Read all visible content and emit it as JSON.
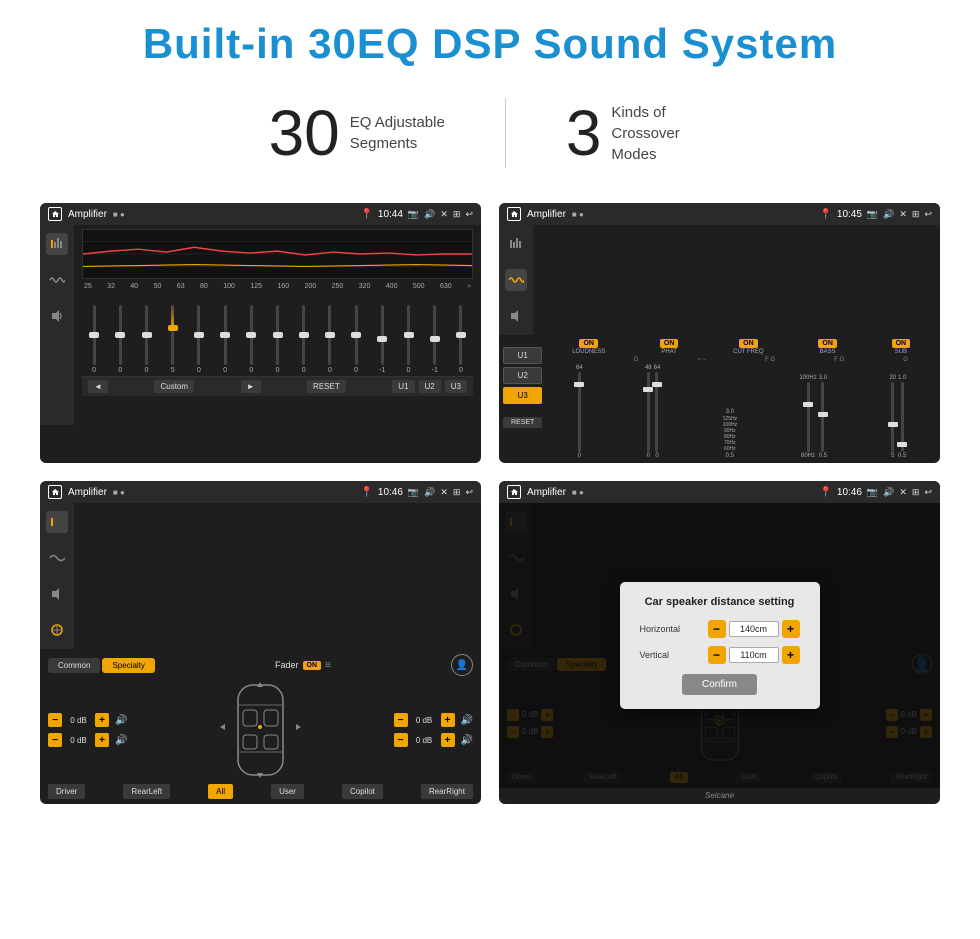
{
  "page": {
    "title": "Built-in 30EQ DSP Sound System",
    "title_color": "#1a8fd1"
  },
  "stats": [
    {
      "number": "30",
      "desc_line1": "EQ Adjustable",
      "desc_line2": "Segments"
    },
    {
      "number": "3",
      "desc_line1": "Kinds of",
      "desc_line2": "Crossover Modes"
    }
  ],
  "screens": [
    {
      "id": "eq",
      "status": {
        "app": "Amplifier",
        "time": "10:44"
      },
      "freq_labels": [
        "25",
        "32",
        "40",
        "50",
        "63",
        "80",
        "100",
        "125",
        "160",
        "200",
        "250",
        "320",
        "400",
        "500",
        "630"
      ],
      "sliders": [
        {
          "value": "0",
          "pos": 50
        },
        {
          "value": "0",
          "pos": 50
        },
        {
          "value": "0",
          "pos": 50
        },
        {
          "value": "5",
          "pos": 42
        },
        {
          "value": "0",
          "pos": 50
        },
        {
          "value": "0",
          "pos": 50
        },
        {
          "value": "0",
          "pos": 50
        },
        {
          "value": "0",
          "pos": 50
        },
        {
          "value": "0",
          "pos": 50
        },
        {
          "value": "0",
          "pos": 50
        },
        {
          "value": "0",
          "pos": 50
        },
        {
          "value": "-1",
          "pos": 54
        },
        {
          "value": "0",
          "pos": 50
        },
        {
          "value": "-1",
          "pos": 54
        },
        {
          "value": "0",
          "pos": 50
        }
      ],
      "bottom_buttons": [
        "Custom",
        "RESET",
        "U1",
        "U2",
        "U3"
      ]
    },
    {
      "id": "crossover",
      "status": {
        "app": "Amplifier",
        "time": "10:45"
      },
      "presets": [
        "U1",
        "U2",
        "U3"
      ],
      "active_preset": "U3",
      "channels": [
        {
          "label": "LOUDNESS",
          "on": true
        },
        {
          "label": "PHAT",
          "on": true
        },
        {
          "label": "CUT FREQ",
          "on": true
        },
        {
          "label": "BASS",
          "on": true
        },
        {
          "label": "SUB",
          "on": true
        }
      ],
      "reset_label": "RESET"
    },
    {
      "id": "fader",
      "status": {
        "app": "Amplifier",
        "time": "10:46"
      },
      "tabs": [
        "Common",
        "Specialty"
      ],
      "active_tab": "Specialty",
      "fader_label": "Fader",
      "fader_on": "ON",
      "db_controls": [
        {
          "label": "0 dB"
        },
        {
          "label": "0 dB"
        },
        {
          "label": "0 dB"
        },
        {
          "label": "0 dB"
        }
      ],
      "position_buttons": [
        "Driver",
        "RearLeft",
        "All",
        "User",
        "Copilot",
        "RearRight"
      ]
    },
    {
      "id": "distance",
      "status": {
        "app": "Amplifier",
        "time": "10:46"
      },
      "tabs": [
        "Common",
        "Specialty"
      ],
      "active_tab": "Specialty",
      "dialog": {
        "title": "Car speaker distance setting",
        "rows": [
          {
            "label": "Horizontal",
            "value": "140cm"
          },
          {
            "label": "Vertical",
            "value": "110cm"
          }
        ],
        "confirm_label": "Confirm"
      },
      "db_controls": [
        {
          "label": "0 dB"
        },
        {
          "label": "0 dB"
        }
      ],
      "position_buttons": [
        "Driver",
        "RearLeft",
        "All",
        "User",
        "Copilot",
        "RearRight"
      ]
    }
  ],
  "watermark": "Seicane"
}
